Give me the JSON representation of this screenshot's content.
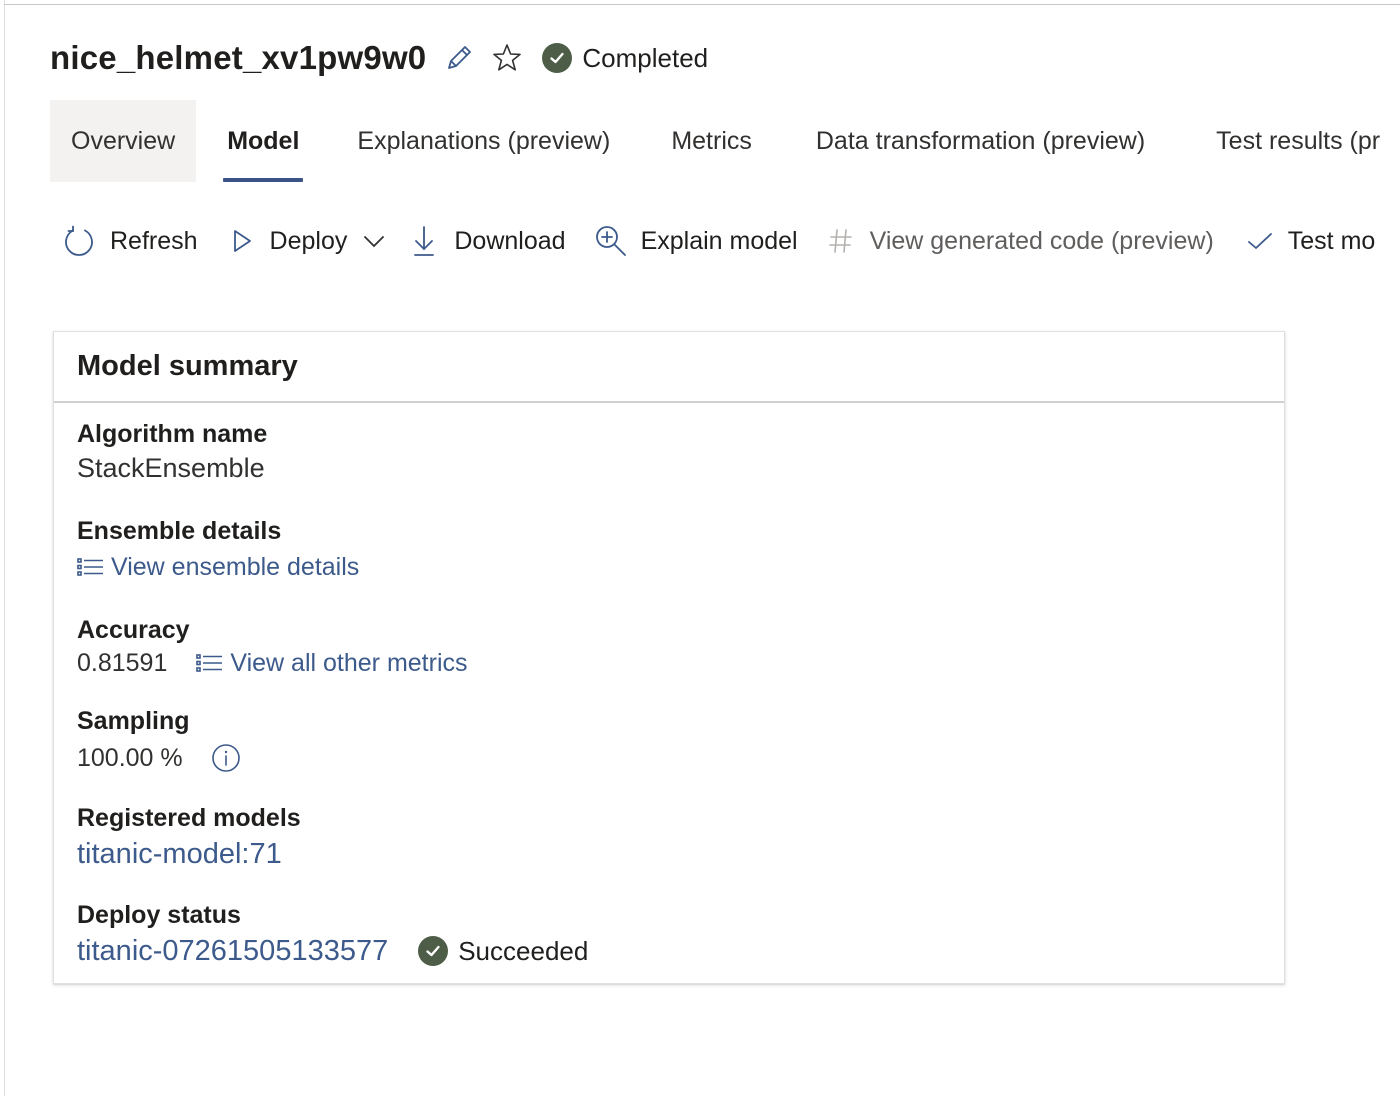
{
  "run": {
    "title": "nice_helmet_xv1pw9w0",
    "edit_icon": "pencil-icon",
    "favorite_icon": "star-icon",
    "status": "Completed",
    "status_icon": "check-circle-icon",
    "status_color": "#4e5d47"
  },
  "tabs": [
    {
      "label": "Overview",
      "selected": false
    },
    {
      "label": "Model",
      "selected": true
    },
    {
      "label": "Explanations (preview)",
      "selected": false
    },
    {
      "label": "Metrics",
      "selected": false
    },
    {
      "label": "Data transformation (preview)",
      "selected": false
    },
    {
      "label": "Test results (pr",
      "selected": false
    }
  ],
  "toolbar": {
    "refresh": {
      "label": "Refresh",
      "icon": "refresh-icon"
    },
    "deploy": {
      "label": "Deploy",
      "icon": "play-icon",
      "dropdown_icon": "chevron-down-icon"
    },
    "download": {
      "label": "Download",
      "icon": "download-icon"
    },
    "explain": {
      "label": "Explain model",
      "icon": "zoom-in-icon"
    },
    "view_code": {
      "label": "View generated code (preview)",
      "icon": "hash-icon",
      "disabled": true
    },
    "test": {
      "label": "Test mo",
      "icon": "checkmark-icon"
    }
  },
  "summary": {
    "title": "Model summary",
    "algorithm": {
      "label": "Algorithm name",
      "value": "StackEnsemble"
    },
    "ensemble": {
      "label": "Ensemble details",
      "link": "View ensemble details",
      "icon": "list-icon"
    },
    "accuracy": {
      "label": "Accuracy",
      "value": "0.81591",
      "link": "View all other metrics",
      "icon": "list-icon"
    },
    "sampling": {
      "label": "Sampling",
      "value": "100.00 %",
      "icon": "info-icon"
    },
    "registered": {
      "label": "Registered models",
      "link": "titanic-model:71"
    },
    "deploy_status": {
      "label": "Deploy status",
      "link": "titanic-07261505133577",
      "status": "Succeeded",
      "status_icon": "check-circle-icon"
    }
  },
  "colors": {
    "accent": "#3b5485",
    "link": "#3c5a8b",
    "success": "#4e5d47",
    "text": "#201f1e"
  }
}
